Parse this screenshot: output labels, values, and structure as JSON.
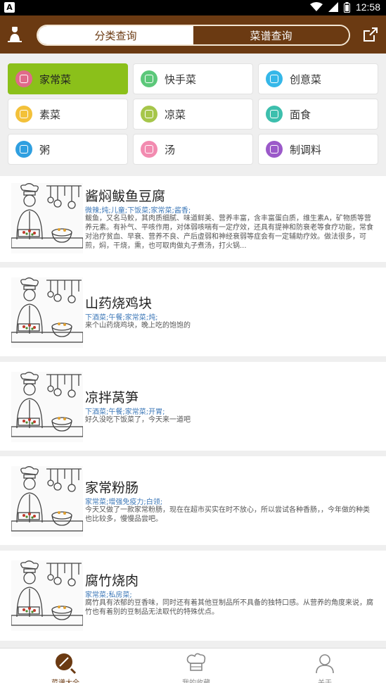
{
  "status_bar": {
    "time": "12:58",
    "icons": [
      "app-a-icon",
      "wifi-icon",
      "signal-icon",
      "battery-icon"
    ]
  },
  "header": {
    "tabs": [
      {
        "label": "分类查询",
        "active": true
      },
      {
        "label": "菜谱查询",
        "active": false
      }
    ],
    "left_icon": "chef-icon",
    "right_icon": "share-icon",
    "colors": {
      "brand": "#6b3a12",
      "active_category": "#8bc01a"
    }
  },
  "categories": [
    {
      "label": "家常菜",
      "icon_color": "#e06a8a",
      "active": true
    },
    {
      "label": "快手菜",
      "icon_color": "#5cc87a",
      "active": false
    },
    {
      "label": "创意菜",
      "icon_color": "#35b7e8",
      "active": false
    },
    {
      "label": "素菜",
      "icon_color": "#f3c13a",
      "active": false
    },
    {
      "label": "凉菜",
      "icon_color": "#a6c64a",
      "active": false
    },
    {
      "label": "面食",
      "icon_color": "#3dbfad",
      "active": false
    },
    {
      "label": "粥",
      "icon_color": "#2f9fe0",
      "active": false
    },
    {
      "label": "汤",
      "icon_color": "#f28bb0",
      "active": false
    },
    {
      "label": "制调料",
      "icon_color": "#9b59c9",
      "active": false
    }
  ],
  "recipes": [
    {
      "title": "酱焖鲅鱼豆腐",
      "tags": "微辣;炖;儿童;下饭菜;家常菜;酱香;",
      "desc": "鲅鱼，又名马鲛，其肉质细腻、味道鲜美、营养丰富，含丰富蛋白质，维生素A，矿物质等营养元素。有补气、平咳作用，对体弱咳喘有一定疗效，还具有提神和防衰老等食疗功能，常食对治疗贫血、早衰、营养不良、产后虚弱和神经衰弱等症会有一定辅助疗效。做法很多，可煎，焖，干烧，熏，也可取肉做丸子煮汤，打火锅..."
    },
    {
      "title": "山药烧鸡块",
      "tags": "下酒菜;午餐;家常菜;炖;",
      "desc": "来个山药烧鸡块，晚上吃的饱饱的"
    },
    {
      "title": "凉拌莴笋",
      "tags": "下酒菜;午餐;家常菜;开胃;",
      "desc": "好久没吃下饭菜了，今天来一道吧"
    },
    {
      "title": "家常粉肠",
      "tags": "家常菜;增强免疫力;白领;",
      "desc": "今天又做了一款家常粉肠，现在在超市买实在时不放心，所以尝试各种香肠，，今年做的种类也比较多，慢慢品尝吧。"
    },
    {
      "title": "腐竹烧肉",
      "tags": "家常菜;私房菜;",
      "desc": "腐竹具有浓郁的豆香味，同时还有着其他豆制品所不具备的独特口感。从营养的角度来说，腐竹也有着别的豆制品无法取代的特殊优点。"
    }
  ],
  "bottom_tabs": [
    {
      "label": "菜谱大全",
      "icon": "recipe-book-icon",
      "active": true
    },
    {
      "label": "我的收藏",
      "icon": "chef-hat-icon",
      "active": false
    },
    {
      "label": "关于",
      "icon": "person-icon",
      "active": false
    }
  ]
}
